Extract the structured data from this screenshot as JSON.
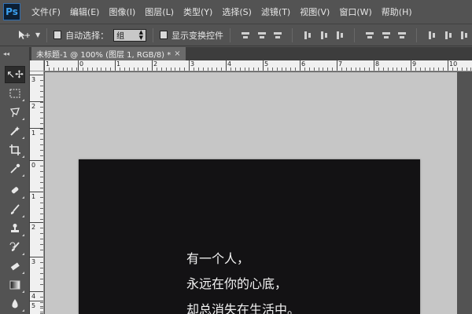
{
  "app": {
    "logo": "Ps"
  },
  "menu": [
    "文件(F)",
    "编辑(E)",
    "图像(I)",
    "图层(L)",
    "类型(Y)",
    "选择(S)",
    "滤镜(T)",
    "视图(V)",
    "窗口(W)",
    "帮助(H)"
  ],
  "options": {
    "auto_select_label": "自动选择：",
    "auto_select_value": "组",
    "show_transform_label": "显示变换控件"
  },
  "document_tab": {
    "title": "未标题-1 @ 100% (图层 1, RGB/8) *",
    "close": "×"
  },
  "ruler_top_labels": [
    "1",
    "0",
    "1",
    "2",
    "3",
    "4",
    "5",
    "6",
    "7",
    "8",
    "9",
    "10",
    "11",
    "12",
    "13"
  ],
  "ruler_left_labels": [
    "3",
    "2",
    "1",
    "0",
    "1",
    "2",
    "3",
    "4",
    "5"
  ],
  "canvas_text": [
    "有一个人，",
    "永远在你的心底，",
    "却总消失在生活中。"
  ]
}
